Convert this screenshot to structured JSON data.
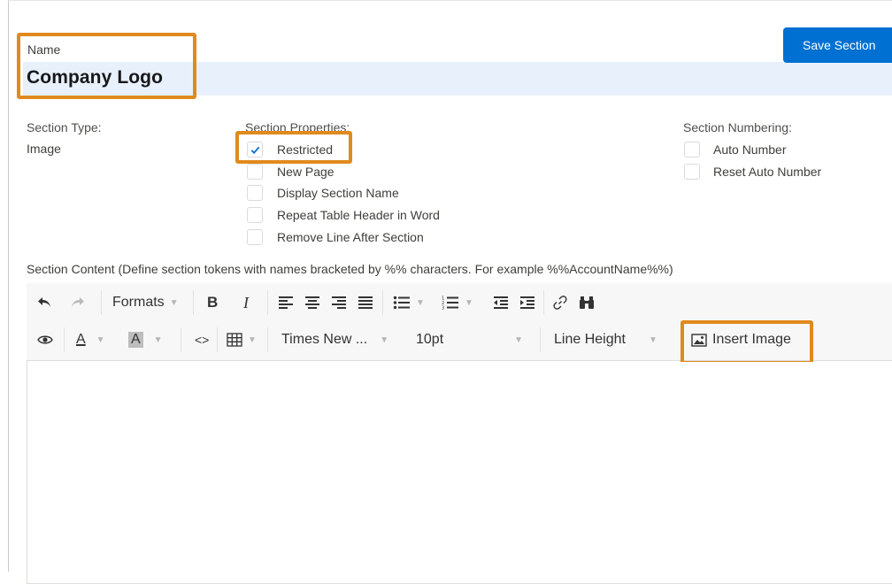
{
  "name_field": {
    "label": "Name",
    "value": "Company Logo"
  },
  "save_button": {
    "label": "Save Section"
  },
  "section_type": {
    "label": "Section Type:",
    "value": "Image"
  },
  "section_properties": {
    "label": "Section Properties:",
    "options": [
      {
        "label": "Restricted",
        "checked": true
      },
      {
        "label": "New Page",
        "checked": false
      },
      {
        "label": "Display Section Name",
        "checked": false
      },
      {
        "label": "Repeat Table Header in Word",
        "checked": false
      },
      {
        "label": "Remove Line After Section",
        "checked": false
      }
    ]
  },
  "section_numbering": {
    "label": "Section Numbering:",
    "options": [
      {
        "label": "Auto Number",
        "checked": false
      },
      {
        "label": "Reset Auto Number",
        "checked": false
      }
    ]
  },
  "section_content": {
    "label": "Section Content (Define section tokens with names bracketed by %% characters. For example %%AccountName%%)"
  },
  "toolbar": {
    "formats_label": "Formats",
    "bold_label": "B",
    "italic_label": "I",
    "font_family_value": "Times New ...",
    "font_size_value": "10pt",
    "line_height_label": "Line Height",
    "insert_image_label": "Insert Image",
    "text_color_label": "A",
    "bg_color_label": "A",
    "code_label": "<>"
  },
  "colors": {
    "brand_button": "#0070d2",
    "highlight": "#e08a1e",
    "name_bar": "#e8f0fb",
    "checkmark": "#0070d2"
  }
}
